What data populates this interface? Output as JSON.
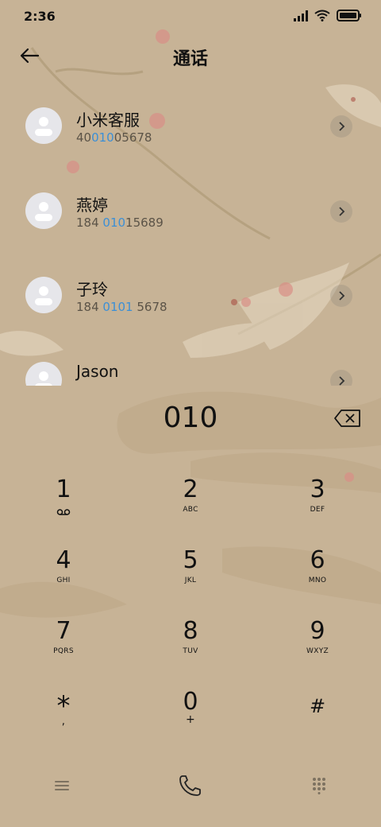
{
  "status": {
    "time": "2:36"
  },
  "header": {
    "title": "通话"
  },
  "contacts": [
    {
      "name": "小米客服",
      "num_pre": "40",
      "num_hl": "010",
      "num_post": "05678"
    },
    {
      "name": "燕婷",
      "num_pre": "184 ",
      "num_hl": "010",
      "num_post": "15689"
    },
    {
      "name": "子玲",
      "num_pre": "184 ",
      "num_hl": "0101",
      "num_post": " 5678"
    },
    {
      "name": "Jason",
      "num_pre": "",
      "num_hl": "",
      "num_post": ""
    }
  ],
  "dialer": {
    "input": "010"
  },
  "keypad": {
    "k1": {
      "digit": "1",
      "letters": ""
    },
    "k2": {
      "digit": "2",
      "letters": "ABC"
    },
    "k3": {
      "digit": "3",
      "letters": "DEF"
    },
    "k4": {
      "digit": "4",
      "letters": "GHI"
    },
    "k5": {
      "digit": "5",
      "letters": "JKL"
    },
    "k6": {
      "digit": "6",
      "letters": "MNO"
    },
    "k7": {
      "digit": "7",
      "letters": "PQRS"
    },
    "k8": {
      "digit": "8",
      "letters": "TUV"
    },
    "k9": {
      "digit": "9",
      "letters": "WXYZ"
    },
    "kstar": {
      "digit": "*",
      "letters": ","
    },
    "k0": {
      "digit": "0",
      "letters": "+"
    },
    "khash": {
      "digit": "#",
      "letters": ""
    }
  },
  "icons": {
    "back": "arrow-left-icon",
    "backspace": "backspace-icon",
    "voicemail": "voicemail-icon",
    "menu": "menu-icon",
    "call": "phone-icon",
    "dialpad": "dialpad-icon"
  },
  "colors": {
    "background": "#c7b396",
    "highlight": "#3b8fd6",
    "text": "#111111"
  }
}
